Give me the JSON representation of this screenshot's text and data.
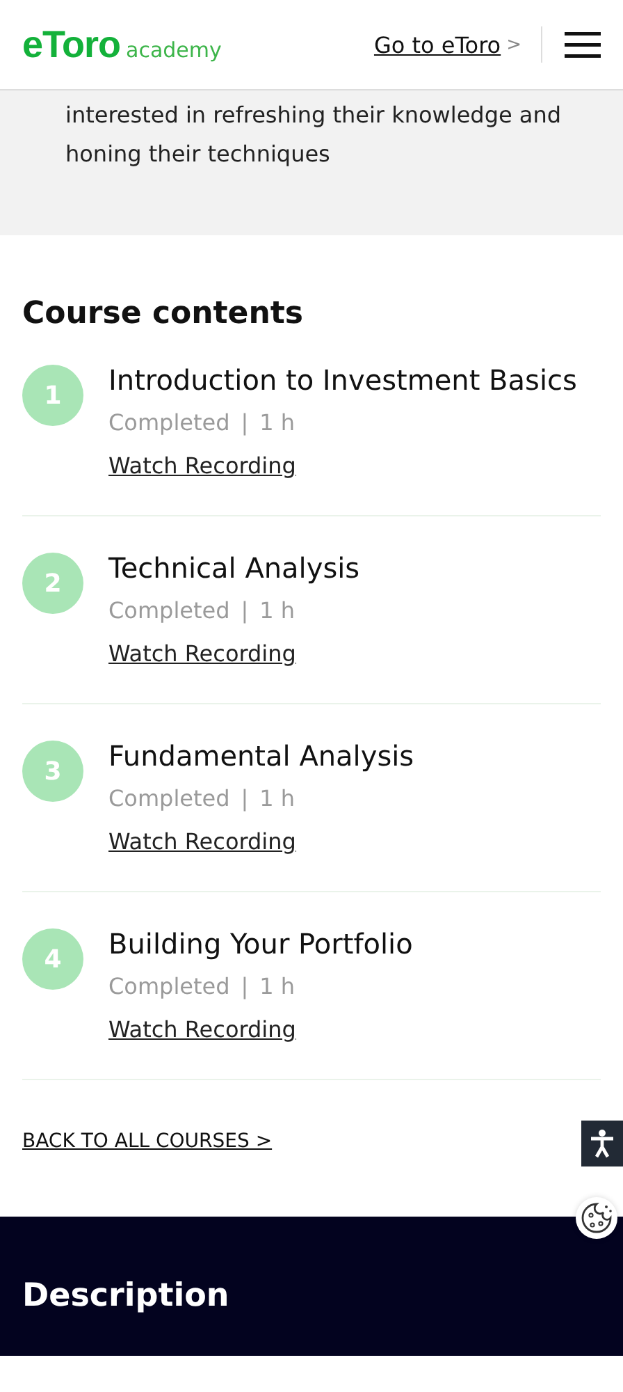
{
  "header": {
    "logo": "eToro",
    "logo_sub": "academy",
    "link": "Go to eToro",
    "link_chevron": ">"
  },
  "intro": {
    "text": "interested in refreshing their knowledge and honing their techniques"
  },
  "course": {
    "heading": "Course contents",
    "lessons": [
      {
        "number": "1",
        "title": "Introduction to Investment Basics",
        "status": "Completed",
        "separator": "|",
        "duration": "1 h",
        "link": "Watch Recording"
      },
      {
        "number": "2",
        "title": "Technical Analysis",
        "status": "Completed",
        "separator": "|",
        "duration": "1 h",
        "link": "Watch Recording"
      },
      {
        "number": "3",
        "title": "Fundamental Analysis",
        "status": "Completed",
        "separator": "|",
        "duration": "1 h",
        "link": "Watch Recording"
      },
      {
        "number": "4",
        "title": "Building Your Portfolio",
        "status": "Completed",
        "separator": "|",
        "duration": "1 h",
        "link": "Watch Recording"
      }
    ],
    "back_link": "BACK TO ALL COURSES >"
  },
  "description": {
    "heading": "Description"
  }
}
